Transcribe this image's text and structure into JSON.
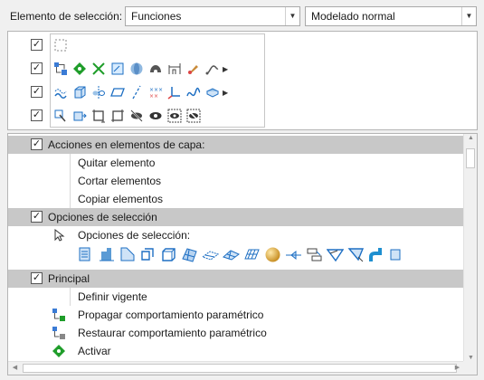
{
  "header": {
    "selection_label": "Elemento de selección:",
    "filter_value": "Funciones",
    "mode_value": "Modelado normal"
  },
  "filter_rows": [
    {
      "checked": true,
      "icons": [
        "empty-selection-box-icon"
      ]
    },
    {
      "checked": true,
      "icons": [
        "feature-tree-icon",
        "activate-diamond-icon",
        "datum-axis-icon",
        "sketch-icon",
        "revolve-icon",
        "shell-icon",
        "dimension-icon",
        "appearance-icon",
        "curve-icon"
      ],
      "has_more": true
    },
    {
      "checked": true,
      "icons": [
        "pattern-icon",
        "box-icon",
        "mirror-icon",
        "plane-icon",
        "axis-icon",
        "coordinate-points-icon",
        "csys-icon",
        "spline-icon",
        "component-icon"
      ],
      "has_more": true
    },
    {
      "checked": true,
      "icons": [
        "query-select-icon",
        "extrude-icon",
        "selection-frame-icon",
        "selection-frame-2-icon",
        "hide-icon",
        "show-icon",
        "show-selected-icon",
        "hide-selected-icon"
      ]
    }
  ],
  "tree": {
    "group1": {
      "label": "Acciones en elementos de capa:",
      "checked": true
    },
    "group1_items": [
      "Quitar elemento",
      "Cortar elementos",
      "Copiar elementos"
    ],
    "group2": {
      "label": "Opciones de selección",
      "checked": true
    },
    "group2_options_label": "Opciones de selección:",
    "group2_icons": [
      "surface-icon",
      "extrude-body-icon",
      "chamfer-icon",
      "round-box-icon",
      "solid-box-icon",
      "mesh-icon",
      "quilt-icon",
      "quilt-2-icon",
      "lattice-icon",
      "sphere-icon",
      "datum-flag-icon",
      "layer-icon",
      "tag-icon",
      "tag-2-icon",
      "pipe-icon",
      "more-icon"
    ],
    "group3": {
      "label": "Principal",
      "checked": true
    },
    "group3_items": [
      {
        "label": "Definir vigente",
        "icon": ""
      },
      {
        "label": "Propagar comportamiento paramétrico",
        "icon": "propagate-icon"
      },
      {
        "label": "Restaurar comportamiento paramétrico",
        "icon": "restore-icon"
      },
      {
        "label": "Activar",
        "icon": "activate-icon"
      }
    ]
  },
  "colors": {
    "group_bg": "#c8c8c8",
    "accent_green": "#1f9d2a",
    "accent_blue": "#1e6fc3"
  }
}
